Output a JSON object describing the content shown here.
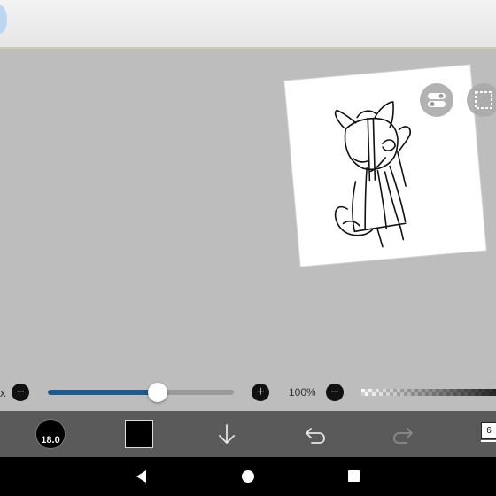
{
  "canvas": {
    "background_color": "#bdbdbd",
    "paper_color": "#ffffff",
    "floating_buttons": [
      {
        "icon": "toggle-switch-icon"
      },
      {
        "icon": "selection-icon"
      }
    ]
  },
  "sliders": {
    "size_label": "x",
    "size_value": 0.6,
    "opacity_label": "100%",
    "accent_color": "#1e5a8c"
  },
  "toolbar": {
    "brush_size": "18.0",
    "current_color": "#000000",
    "layer_count": "6",
    "icons": [
      "brush-size-icon",
      "color-swatch",
      "download-icon",
      "undo-icon",
      "redo-icon",
      "layers-icon"
    ]
  },
  "navbar": {
    "icons": [
      "back-icon",
      "home-icon",
      "recent-apps-icon"
    ]
  }
}
